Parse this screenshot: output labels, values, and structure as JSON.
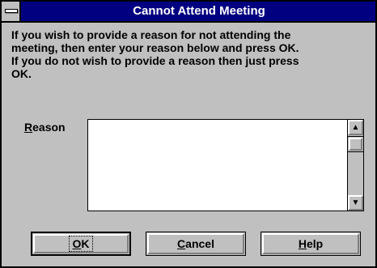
{
  "window": {
    "title": "Cannot Attend Meeting"
  },
  "message": "If you wish to provide a reason for not attending the\nmeeting, then enter your reason below and press OK.\nIf you do not wish to provide a reason then just press\nOK.",
  "reason": {
    "label_mnemonic": "R",
    "label_rest": "eason",
    "value": ""
  },
  "scrollbar": {
    "up_glyph": "▲",
    "down_glyph": "▼"
  },
  "buttons": {
    "ok": {
      "mnemonic": "O",
      "rest": "K"
    },
    "cancel": {
      "mnemonic": "C",
      "rest": "ancel"
    },
    "help": {
      "mnemonic": "H",
      "rest": "elp"
    }
  },
  "colors": {
    "title_bar": "#000080",
    "face": "#c0c0c0"
  }
}
